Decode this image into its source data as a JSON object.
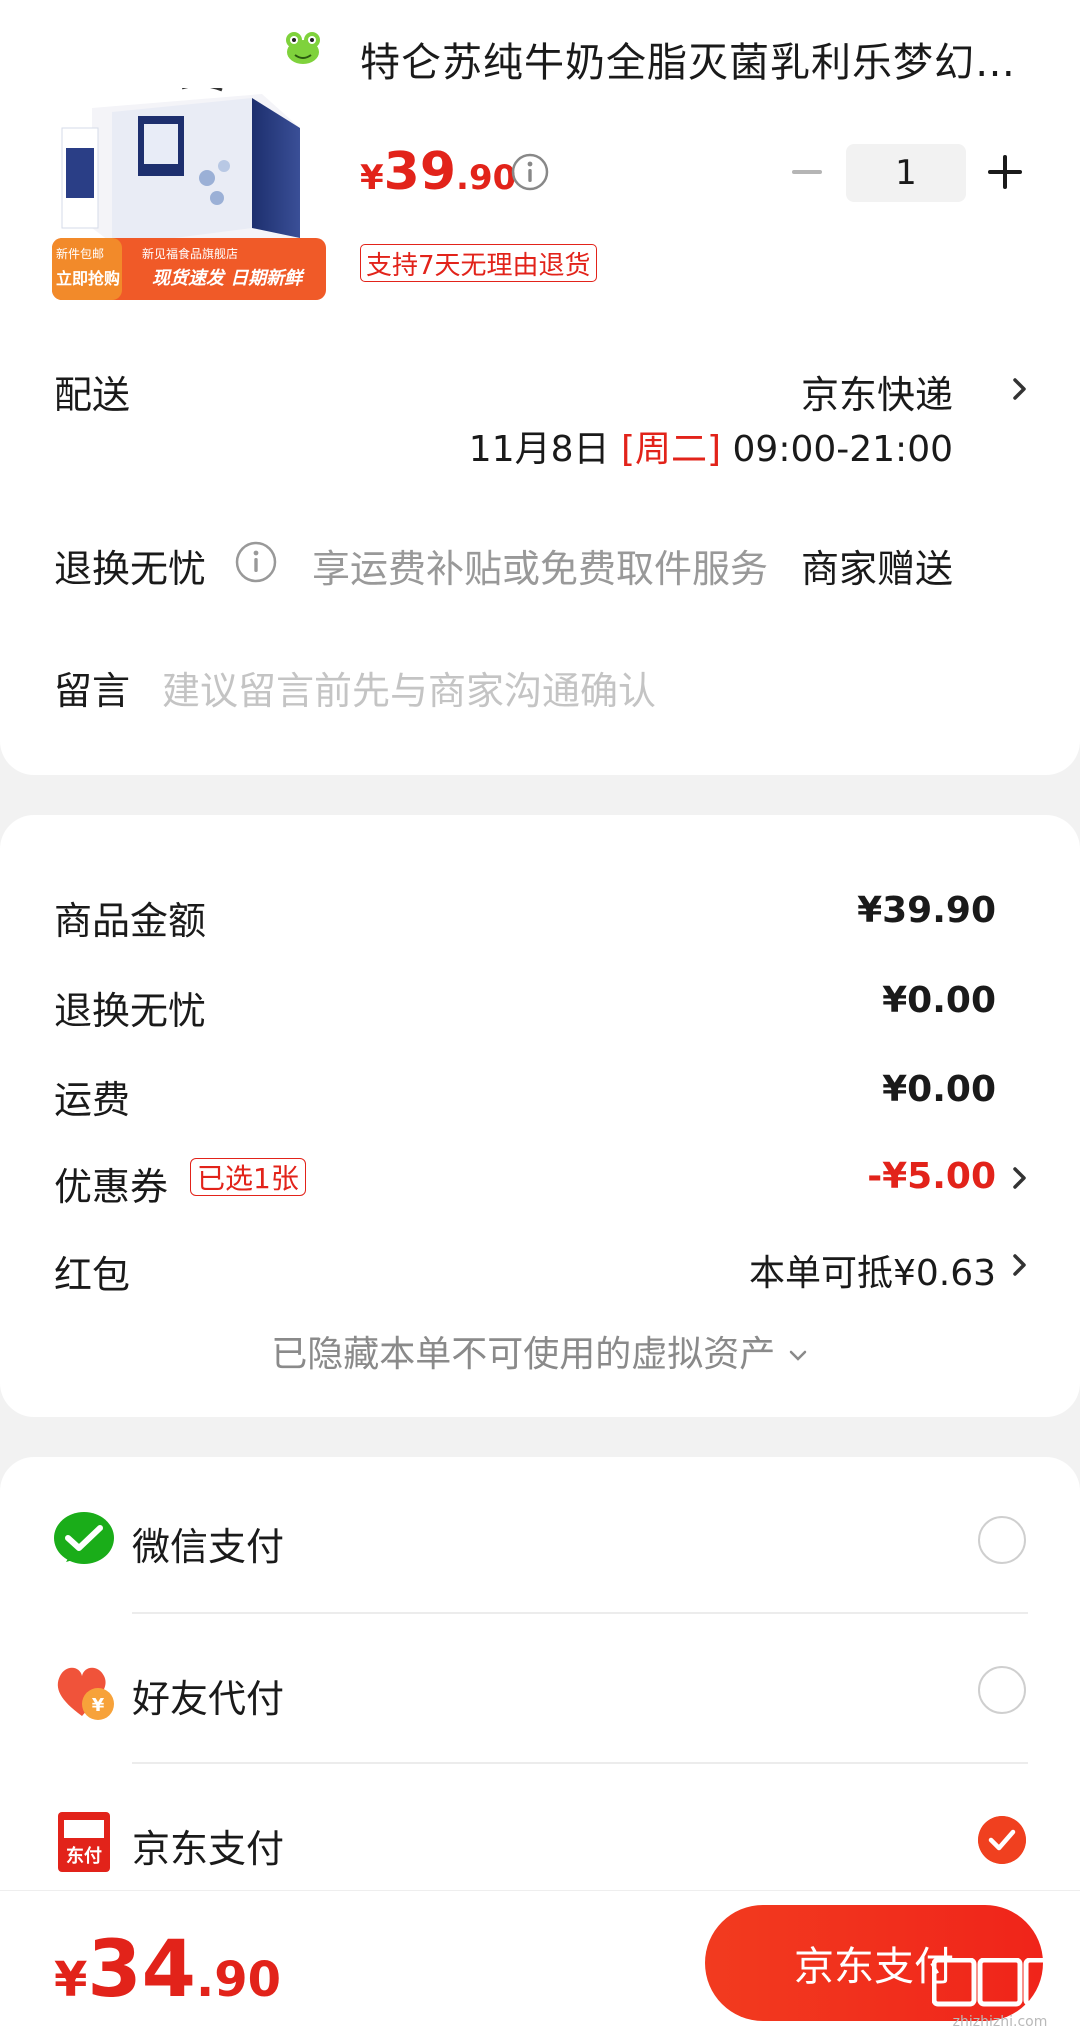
{
  "product": {
    "title": "特仑苏纯牛奶全脂灭菌乳利乐梦幻盖…",
    "price_currency": "¥",
    "price_int": "39",
    "price_dec": ".90",
    "quantity": "1",
    "return_badge": "支持7天无理由退货",
    "image_banner": {
      "line1": "新见福食品旗舰店",
      "tag_top": "新件包邮",
      "tag_main": "立即抢购",
      "slogan": "现货速发 日期新鲜"
    }
  },
  "delivery": {
    "label": "配送",
    "carrier": "京东快递",
    "date": "11月8日",
    "weekday": "[周二]",
    "time": "09:00-21:00"
  },
  "worry_free": {
    "label": "退换无忧",
    "desc": "享运费补贴或免费取件服务",
    "value": "商家赠送"
  },
  "message": {
    "label": "留言",
    "placeholder": "建议留言前先与商家沟通确认"
  },
  "summary": {
    "goods_label": "商品金额",
    "goods_value": "¥39.90",
    "worry_label": "退换无忧",
    "worry_value": "¥0.00",
    "shipping_label": "运费",
    "shipping_value": "¥0.00",
    "coupon_label": "优惠券",
    "coupon_tag": "已选1张",
    "coupon_value": "-¥5.00",
    "redpacket_label": "红包",
    "redpacket_value": "本单可抵¥0.63",
    "hidden_text": "已隐藏本单不可使用的虚拟资产"
  },
  "payment": {
    "options": [
      {
        "label": "微信支付",
        "icon": "wechat-pay-icon",
        "checked": false
      },
      {
        "label": "好友代付",
        "icon": "friend-pay-icon",
        "checked": false
      },
      {
        "label": "京东支付",
        "icon": "jd-pay-icon",
        "icon_text": "东付",
        "checked": true
      }
    ]
  },
  "footer": {
    "total_currency": "¥",
    "total_int": "34",
    "total_dec": ".90",
    "pay_button": "京东支付",
    "watermark_text": "zhizhizhi.com"
  },
  "colors": {
    "accent": "#e2231a",
    "button": "#f0241a",
    "wechat": "#1aad19"
  }
}
